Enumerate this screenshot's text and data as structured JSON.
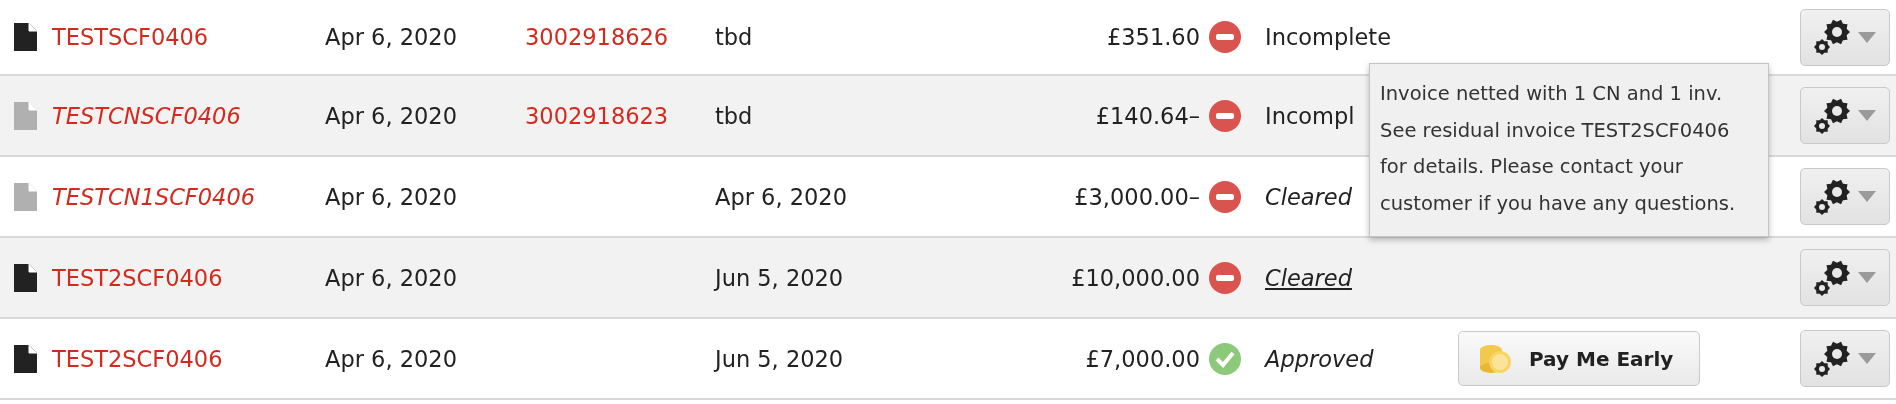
{
  "rows": [
    {
      "document": "TESTSCF0406",
      "credit_note": false,
      "date": "Apr 6, 2020",
      "reference": "3002918626",
      "due": "tbd",
      "amount": "£351.60",
      "status": {
        "kind": "blocked",
        "label": "Incomplete",
        "italic": false,
        "link": false
      }
    },
    {
      "document": "TESTCNSCF0406",
      "credit_note": true,
      "date": "Apr 6, 2020",
      "reference": "3002918623",
      "due": "tbd",
      "amount": "£140.64–",
      "status": {
        "kind": "blocked",
        "label": "Incompl",
        "italic": false,
        "link": false
      }
    },
    {
      "document": "TESTCN1SCF0406",
      "credit_note": true,
      "date": "Apr 6, 2020",
      "due": "Apr 6, 2020",
      "amount": "£3,000.00–",
      "status": {
        "kind": "blocked",
        "label": "Cleared",
        "italic": true,
        "link": false
      }
    },
    {
      "document": "TEST2SCF0406",
      "credit_note": false,
      "date": "Apr 6, 2020",
      "due": "Jun 5, 2020",
      "amount": "£10,000.00",
      "status": {
        "kind": "blocked",
        "label": "Cleared",
        "italic": true,
        "link": true
      }
    },
    {
      "document": "TEST2SCF0406",
      "credit_note": false,
      "date": "Apr 6, 2020",
      "due": "Jun 5, 2020",
      "amount": "£7,000.00",
      "status": {
        "kind": "ok",
        "label": "Approved",
        "italic": true,
        "link": false
      },
      "action": "Pay Me Early"
    }
  ],
  "tooltip": {
    "text": "Invoice netted with 1 CN and 1 inv. See residual invoice TEST2SCF0406 for details. Please contact your customer if you have any questions."
  }
}
